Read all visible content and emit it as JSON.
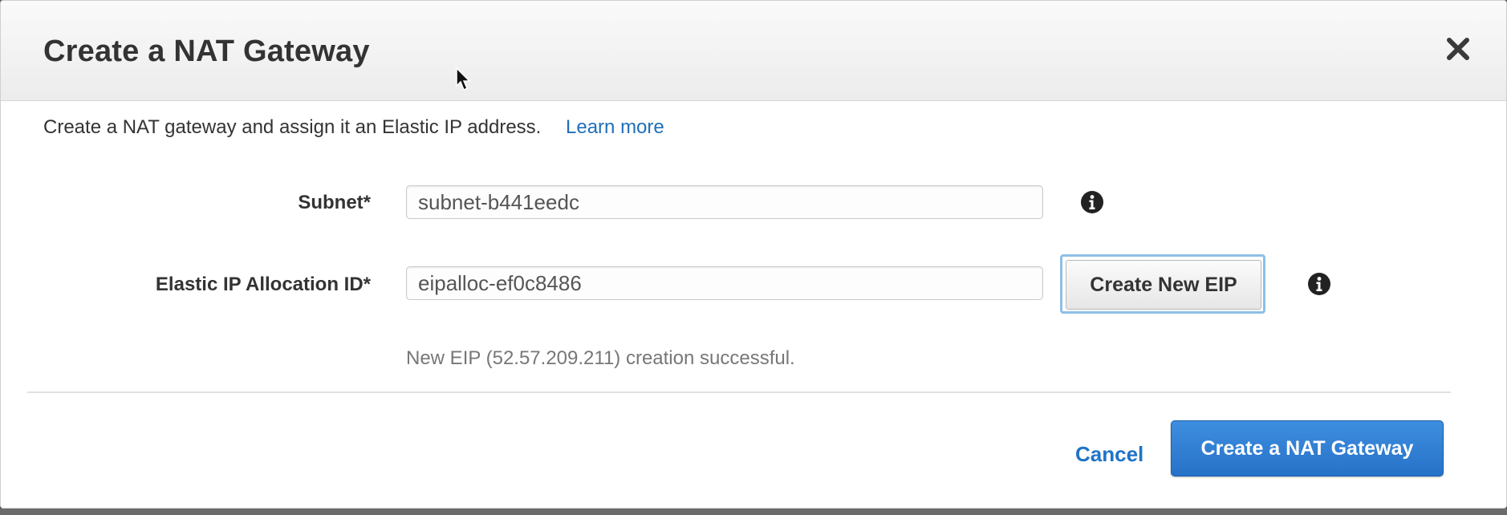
{
  "dialog": {
    "title": "Create a NAT Gateway",
    "close_icon": "close-icon"
  },
  "intro": {
    "text": "Create a NAT gateway and assign it an Elastic IP address.",
    "link_label": "Learn more"
  },
  "form": {
    "subnet": {
      "label": "Subnet*",
      "value": "subnet-b441eedc",
      "info_icon": "info-icon"
    },
    "eip": {
      "label": "Elastic IP Allocation ID*",
      "value": "eipalloc-ef0c8486",
      "create_button_label": "Create New EIP",
      "info_icon": "info-icon"
    },
    "success_message": "New EIP (52.57.209.211) creation successful."
  },
  "footer": {
    "cancel_label": "Cancel",
    "submit_label": "Create a NAT Gateway"
  },
  "colors": {
    "primary": "#2672c8",
    "link": "#1f6fb9",
    "focus_ring": "#8dbfe8"
  }
}
